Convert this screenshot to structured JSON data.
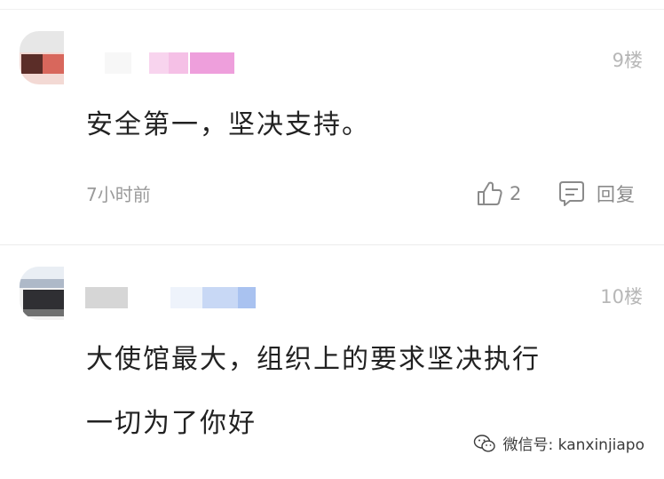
{
  "comments": [
    {
      "floor": "9楼",
      "text": "安全第一，坚决支持。",
      "time": "7小时前",
      "likes": "2",
      "reply_label": "回复",
      "colors": {
        "avatar": [
          "#e7e7e7",
          "#f3d9d4",
          "#5b2d28",
          "#d8675c"
        ],
        "username_blocks": [
          "#f7f7f7",
          "#f8d4ee",
          "#f5c0e6",
          "#ee9fdc"
        ]
      }
    },
    {
      "floor": "10楼",
      "lines": [
        "大使馆最大，组织上的要求坚决执行",
        "一切为了你好"
      ],
      "colors": {
        "avatar": [
          "#e9eef4",
          "#aeb9c8",
          "#2f2f33",
          "#6f7070"
        ],
        "username_blocks": [
          "#d6d6d6",
          "#eef3fb",
          "#c8d8f5",
          "#a9c2f0"
        ]
      }
    }
  ],
  "watermark": {
    "text": "微信号: kanxinjiapo",
    "icon": "wechat-icon"
  }
}
